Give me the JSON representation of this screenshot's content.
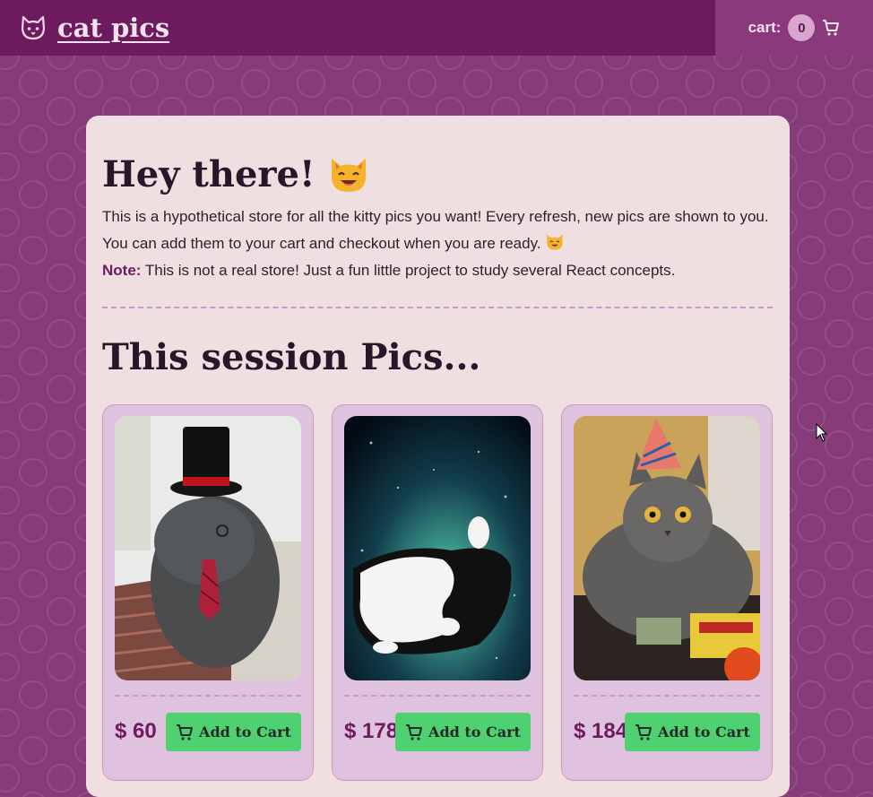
{
  "header": {
    "brand": "cat pics",
    "cart_label": "cart:",
    "cart_count": "0"
  },
  "intro": {
    "title": "Hey there!",
    "text": "This is a hypothetical store for all the kitty pics you want! Every refresh, new pics are shown to you. You can add them to your cart and checkout when you are ready.",
    "note_label": "Note:",
    "note_text": "This is not a real store! Just a fun little project to study several React concepts."
  },
  "session": {
    "title": "This session Pics..."
  },
  "products": [
    {
      "price": "$ 60",
      "button": "Add to Cart",
      "photo": "cat-with-top-hat-and-tie"
    },
    {
      "price": "$ 178",
      "button": "Add to Cart",
      "photo": "cat-floating-in-galaxy"
    },
    {
      "price": "$ 184",
      "button": "Add to Cart",
      "photo": "gray-cat-with-party-hat"
    }
  ],
  "colors": {
    "topbar": "#6d1a5e",
    "page_bg": "#853c78",
    "panel_bg": "#efdfe1",
    "accent": "#6d1a5e",
    "button": "#4fd172"
  },
  "icons": [
    "cat-logo-icon",
    "cart-icon",
    "cat-face-emoji"
  ]
}
